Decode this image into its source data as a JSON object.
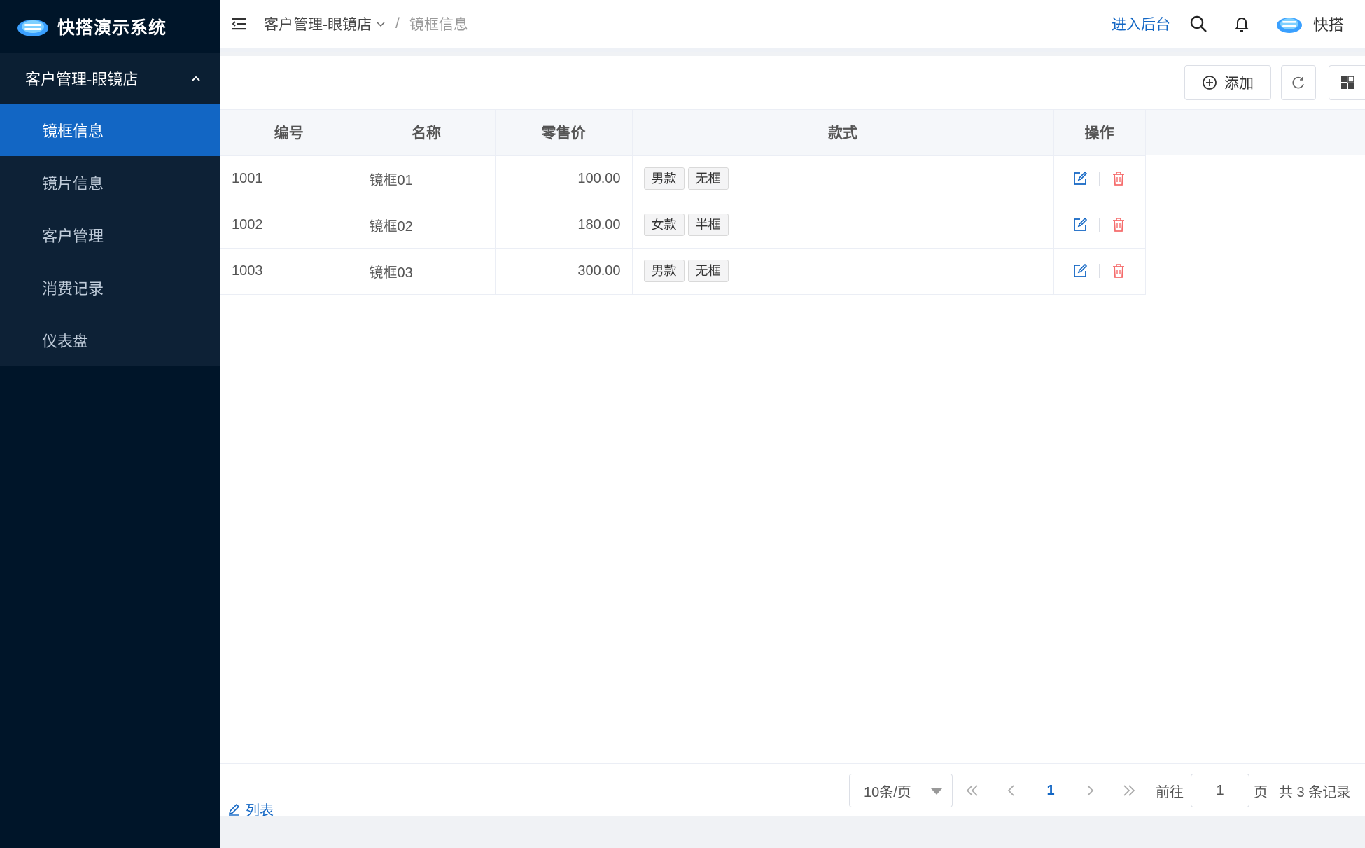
{
  "app": {
    "title": "快搭演示系统"
  },
  "sidebar": {
    "group": "客户管理-眼镜店",
    "items": [
      {
        "label": "镜框信息",
        "active": true
      },
      {
        "label": "镜片信息",
        "active": false
      },
      {
        "label": "客户管理",
        "active": false
      },
      {
        "label": "消费记录",
        "active": false
      },
      {
        "label": "仪表盘",
        "active": false
      }
    ]
  },
  "header": {
    "breadcrumb": [
      "客户管理-眼镜店",
      "镜框信息"
    ],
    "breadcrumb_sep": "/",
    "enter_admin": "进入后台",
    "username": "快搭"
  },
  "toolbar": {
    "add_label": "添加"
  },
  "table": {
    "columns": [
      "编号",
      "名称",
      "零售价",
      "款式",
      "操作"
    ],
    "rows": [
      {
        "id": "1001",
        "name": "镜框01",
        "price": "100.00",
        "tags": [
          "男款",
          "无框"
        ]
      },
      {
        "id": "1002",
        "name": "镜框02",
        "price": "180.00",
        "tags": [
          "女款",
          "半框"
        ]
      },
      {
        "id": "1003",
        "name": "镜框03",
        "price": "300.00",
        "tags": [
          "男款",
          "无框"
        ]
      }
    ]
  },
  "footer": {
    "list_label": "列表",
    "page_size": "10条/页",
    "current_page": "1",
    "goto_label": "前往",
    "goto_value": "1",
    "page_unit": "页",
    "total": "共 3 条记录"
  },
  "colors": {
    "primary": "#1266c4",
    "sidebar_bg": "#001529",
    "danger": "#f56c6c"
  }
}
